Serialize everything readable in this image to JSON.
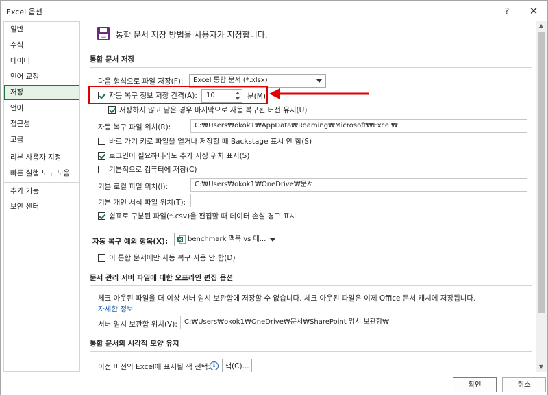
{
  "window": {
    "title": "Excel 옵션",
    "help": "?",
    "close": "✕"
  },
  "sidebar": {
    "items": [
      {
        "label": "일반"
      },
      {
        "label": "수식"
      },
      {
        "label": "데이터"
      },
      {
        "label": "언어 교정"
      },
      {
        "label": "저장"
      },
      {
        "label": "언어"
      },
      {
        "label": "접근성"
      },
      {
        "label": "고급"
      },
      {
        "label": "리본 사용자 지정"
      },
      {
        "label": "빠른 실행 도구 모음"
      },
      {
        "label": "추가 기능"
      },
      {
        "label": "보안 센터"
      }
    ],
    "selected_index": 4
  },
  "header": {
    "title": "통합 문서 저장 방법을 사용자가 지정합니다."
  },
  "save_section": {
    "title": "통합 문서 저장",
    "format_label": "다음 형식으로 파일 저장(F):",
    "format_value": "Excel 통합 문서 (*.xlsx)",
    "autorecover_label": "자동 복구 정보 저장 간격(A):",
    "autorecover_checked": true,
    "autorecover_minutes": "10",
    "minutes_unit": "분(M)",
    "keep_last_label": "저장하지 않고 닫은 경우 마지막으로 자동 복구된 버전 유지(U)",
    "keep_last_checked": true,
    "autorecover_location_label": "자동 복구 파일 위치(R):",
    "autorecover_location_value": "C:₩Users₩okok1₩AppData₩Roaming₩Microsoft₩Excel₩",
    "backstage_label": "바로 가기 키로 파일을 열거나 저장할 때 Backstage 표시 안 함(S)",
    "backstage_checked": false,
    "signin_label": "로그인이 필요하더라도 추가 저장 위치 표시(S)",
    "signin_checked": true,
    "default_computer_label": "기본적으로 컴퓨터에 저장(C)",
    "default_computer_checked": false,
    "default_local_label": "기본 로컬 파일 위치(I):",
    "default_local_value": "C:₩Users₩okok1₩OneDrive₩문서",
    "personal_templates_label": "기본 개인 서식 파일 위치(T):",
    "personal_templates_value": "",
    "csv_label": "쉼표로 구분된 파일(*.csv)을 편집할 때 데이터 손실 경고 표시",
    "csv_checked": true
  },
  "exceptions_section": {
    "title": "자동 복구 예외 항목(X):",
    "workbook_value": "benchmark 맥북 vs 데...",
    "disable_label": "이 통합 문서에만 자동 복구 사용 안 함(D)",
    "disable_checked": false
  },
  "offline_section": {
    "title": "문서 관리 서버 파일에 대한 오프라인 편집 옵션",
    "description": "체크 아웃된 파일을 더 이상 서버 임시 보관함에 저장할 수 없습니다. 체크 아웃된 파일은 이제 Office 문서 캐시에 저장됩니다.",
    "more_info": "자세한 정보",
    "drafts_label": "서버 임시 보관함 위치(V):",
    "drafts_value": "C:₩Users₩okok1₩OneDrive₩문서₩SharePoint 임시 보관함₩"
  },
  "visual_section": {
    "title": "통합 문서의 시각적 모양 유지",
    "colors_label": "이전 버전의 Excel에 표시될 색 선택:",
    "colors_button": "색(C)..."
  },
  "footer": {
    "ok": "확인",
    "cancel": "취소"
  },
  "colors": {
    "accent": "#217346",
    "highlight": "#e00000",
    "link": "#1f5fa8"
  }
}
